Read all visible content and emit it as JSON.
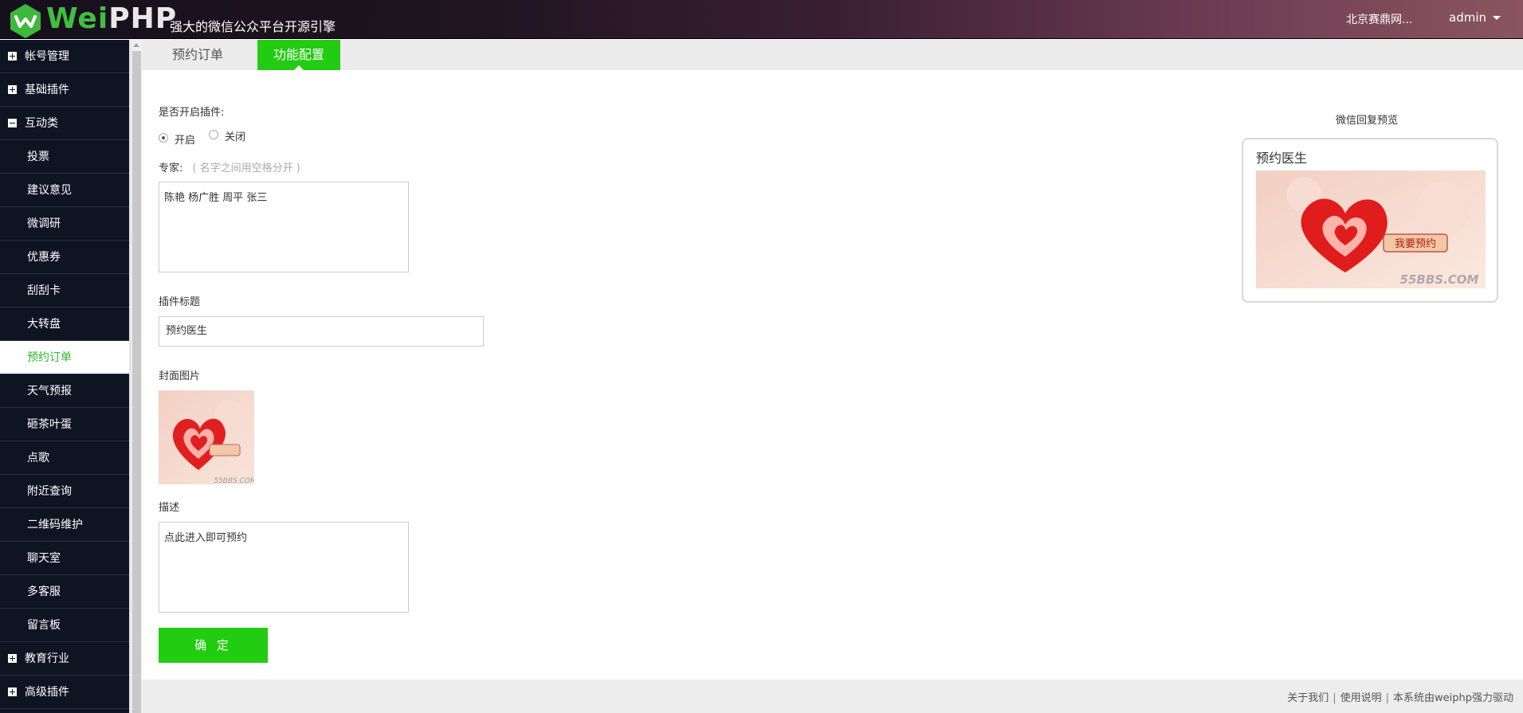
{
  "header": {
    "logo_wei": "Wei",
    "logo_php": "PHP",
    "slogan": "强大的微信公众平台开源引擎",
    "account": "北京赛鼎网...",
    "user": "admin"
  },
  "sidebar": {
    "items": [
      {
        "label": "帐号管理",
        "kind": "group",
        "toggle": "plus"
      },
      {
        "label": "基础插件",
        "kind": "group",
        "toggle": "plus"
      },
      {
        "label": "互动类",
        "kind": "group",
        "toggle": "minus"
      },
      {
        "label": "投票",
        "kind": "sub"
      },
      {
        "label": "建议意见",
        "kind": "sub"
      },
      {
        "label": "微调研",
        "kind": "sub"
      },
      {
        "label": "优惠券",
        "kind": "sub"
      },
      {
        "label": "刮刮卡",
        "kind": "sub"
      },
      {
        "label": "大转盘",
        "kind": "sub"
      },
      {
        "label": "预约订单",
        "kind": "sub",
        "active": true
      },
      {
        "label": "天气预报",
        "kind": "sub"
      },
      {
        "label": "砸茶叶蛋",
        "kind": "sub"
      },
      {
        "label": "点歌",
        "kind": "sub"
      },
      {
        "label": "附近查询",
        "kind": "sub"
      },
      {
        "label": "二维码维护",
        "kind": "sub"
      },
      {
        "label": "聊天室",
        "kind": "sub"
      },
      {
        "label": "多客服",
        "kind": "sub"
      },
      {
        "label": "留言板",
        "kind": "sub"
      },
      {
        "label": "教育行业",
        "kind": "group",
        "toggle": "plus"
      },
      {
        "label": "高级插件",
        "kind": "group",
        "toggle": "plus"
      }
    ]
  },
  "tabs": {
    "orders": "预约订单",
    "config": "功能配置"
  },
  "form": {
    "enable_label": "是否开启插件:",
    "radio_on": "开启",
    "radio_off": "关闭",
    "expert_label": "专家:",
    "expert_hint": "( 名字之间用空格分开 )",
    "expert_value": "陈艳 杨广胜 周平 张三",
    "title_label": "插件标题",
    "title_value": "预约医生",
    "cover_label": "封面图片",
    "desc_label": "描述",
    "desc_value": "点此进入即可预约",
    "submit": "确 定"
  },
  "preview": {
    "heading": "微信回复预览",
    "card_title": "预约医生",
    "image_button_text": "我要预约",
    "watermark": "55BBS.COM"
  },
  "footer": {
    "about": "关于我们",
    "usage": "使用说明",
    "powered": "本系统由weiphp强力驱动"
  },
  "colors": {
    "accent": "#22cc11",
    "sidebar_bg": "#0e1422"
  }
}
